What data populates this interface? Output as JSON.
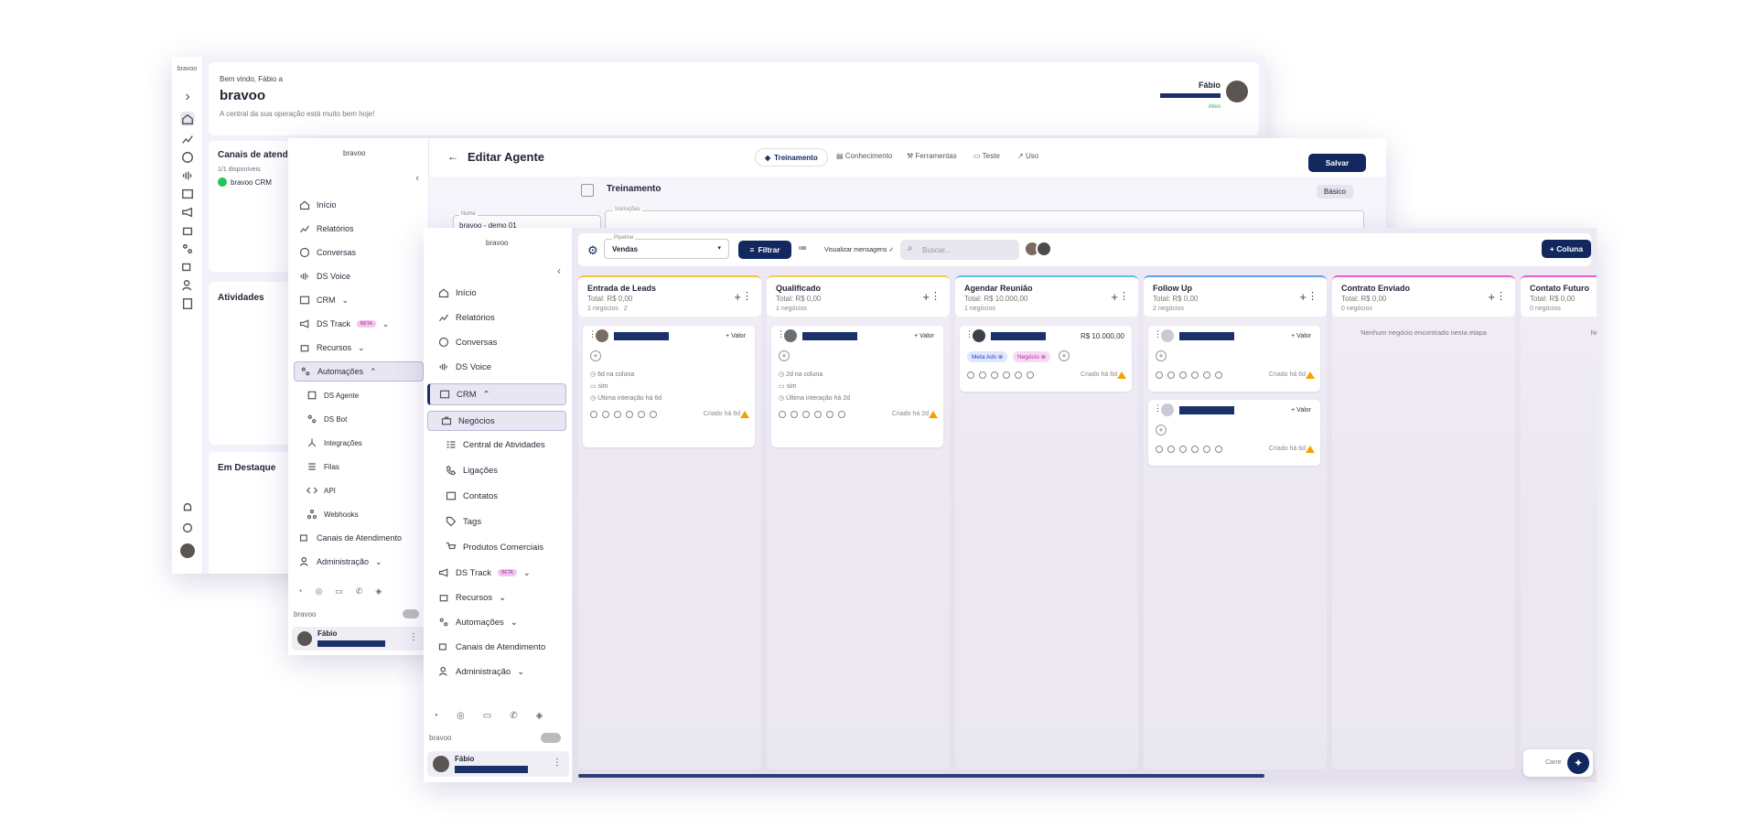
{
  "w1": {
    "logo": "bravoo",
    "welcome": "Bem vindo, Fábio a",
    "company": "bravoo",
    "subtitle": "A central da sua operação está muito bem hoje!",
    "user_name": "Fábio",
    "user_status": "Ativo",
    "channels_title": "Canais de atendimento",
    "channels_count": "1/1 disponíveis",
    "channel_name": "bravoo CRM",
    "activities_title": "Atividades",
    "featured_title": "Em Destaque"
  },
  "w2": {
    "logo": "bravoo",
    "page_title": "Editar Agente",
    "tabs": [
      "Treinamento",
      "Conhecimento",
      "Ferramentas",
      "Teste",
      "Uso"
    ],
    "save": "Salvar",
    "section": "Treinamento",
    "mode": "Básico",
    "name_label": "Nome",
    "name_value": "bravoo - demo 01",
    "instructions_label": "Instruções",
    "nav": [
      "Início",
      "Relatórios",
      "Conversas",
      "DS Voice",
      "CRM",
      "DS Track",
      "Recursos",
      "Automações"
    ],
    "beta": "BETA",
    "sub_nav": [
      "DS Agente",
      "DS Bot",
      "Integrações",
      "Filas",
      "API",
      "Webhooks"
    ],
    "nav_bottom": [
      "Canais de Atendimento",
      "Administração"
    ],
    "org": "bravoo",
    "user": "Fábio"
  },
  "w3": {
    "logo": "bravoo",
    "nav": [
      "Início",
      "Relatórios",
      "Conversas",
      "DS Voice",
      "CRM"
    ],
    "crm_sub": [
      "Negócios",
      "Central de Atividades",
      "Ligações",
      "Contatos",
      "Tags",
      "Produtos Comerciais"
    ],
    "nav_bottom": [
      "DS Track",
      "Recursos",
      "Automações",
      "Canais de Atendimento",
      "Administração"
    ],
    "beta": "BETA",
    "org": "bravoo",
    "user": "Fábio",
    "pipeline_label": "Pipeline",
    "pipeline_value": "Vendas",
    "filter": "Filtrar",
    "view_messages": "Visualizar mensagens",
    "search_placeholder": "Buscar...",
    "add_column": "+ Coluna",
    "add_value": "+ Valor",
    "loading": "Carre",
    "columns": [
      {
        "title": "Entrada de Leads",
        "total": "Total: R$ 0,00",
        "count": "1 negócios",
        "extra": "2",
        "color": "#f0c53a"
      },
      {
        "title": "Qualificado",
        "total": "Total: R$ 0,00",
        "count": "1 negócios",
        "color": "#e9d24a"
      },
      {
        "title": "Agendar Reunião",
        "total": "Total: R$ 10.000,00",
        "count": "1 negócios",
        "color": "#58c2e8"
      },
      {
        "title": "Follow Up",
        "total": "Total: R$ 0,00",
        "count": "2 negócios",
        "color": "#5aa0e6"
      },
      {
        "title": "Contrato Enviado",
        "total": "Total: R$ 0,00",
        "count": "0 negócios",
        "empty": "Nenhum negócio encontrado nesta etapa",
        "color": "#e45fc6"
      },
      {
        "title": "Contato Futuro",
        "total": "Total: R$ 0,00",
        "count": "0 negócios",
        "empty": "Nenhum negó",
        "color": "#e45fc6"
      }
    ],
    "card1": {
      "m1": "6d na coluna",
      "m2": "sim",
      "m3": "Última interação há 6d",
      "created": "Criado há 6d"
    },
    "card2": {
      "m1": "2d na coluna",
      "m2": "sim",
      "m3": "Última interação há 2d",
      "created": "Criado há 2d"
    },
    "card3": {
      "value": "R$ 10.000,00",
      "tag1": "Meta Ads",
      "tag2": "Negócio",
      "created": "Criado há 6d"
    },
    "card4": {
      "created": "Criado há 6d"
    },
    "card5": {
      "created": "Criado há 6d"
    }
  }
}
